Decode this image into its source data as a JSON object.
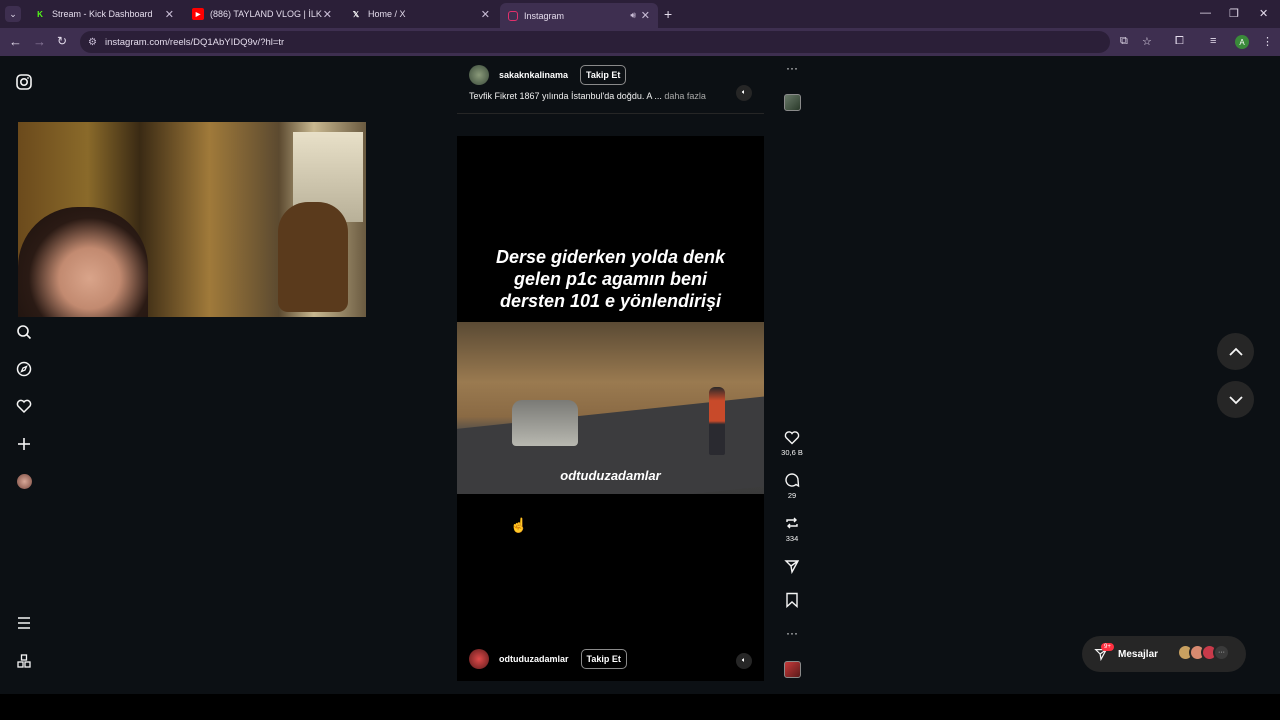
{
  "browser": {
    "tabs": [
      {
        "title": "Stream - Kick Dashboard",
        "favicon": "kick-icon",
        "color": "#53fc18"
      },
      {
        "title": "(886) TAYLAND VLOG | İLK GÜN",
        "favicon": "youtube-icon",
        "color": "#ff0000"
      },
      {
        "title": "Home / X",
        "favicon": "x-icon",
        "color": "#ffffff"
      },
      {
        "title": "Instagram",
        "favicon": "instagram-icon",
        "color": "#e1306c"
      }
    ],
    "url": "instagram.com/reels/DQ1AbYIDQ9v/?hl=tr",
    "profile_initial": "A"
  },
  "top_post": {
    "username": "sakaknkalinama",
    "follow_label": "Takip Et",
    "description": "Tevfik Fikret 1867 yılında İstanbul'da doğdu. A ...",
    "more_label": "daha fazla"
  },
  "reel": {
    "caption_lines": [
      "Derse giderken yolda denk",
      "gelen p1c agamın beni",
      "dersten 101 e yönlendirişi"
    ],
    "watermark": "odtuduzadamlar",
    "username": "odtuduzadamlar",
    "follow_label": "Takip Et"
  },
  "actions": {
    "likes": "30,6 B",
    "comments": "29",
    "reposts": "334"
  },
  "messages": {
    "label": "Mesajlar",
    "badge": "9+"
  },
  "colors": {
    "page_bg": "#0c1014",
    "browser_frame": "#2b1f38",
    "toolbar": "#3e2f50",
    "notification": "#ff3040"
  }
}
